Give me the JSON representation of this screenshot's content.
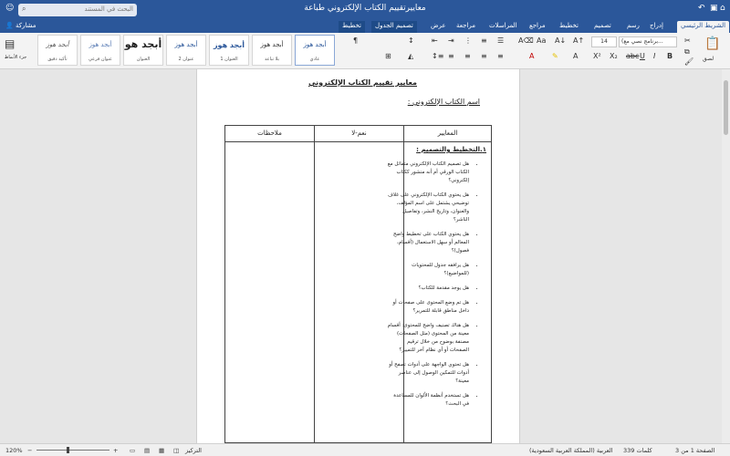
{
  "window": {
    "title": "معاييرتقييم الكتاب الإلكتروني طباعة",
    "search_placeholder": "البحث في المستند"
  },
  "share_label": "مشاركة",
  "tabs": [
    {
      "label": "الشريط الرئيسي"
    },
    {
      "label": "إدراج"
    },
    {
      "label": "رسم"
    },
    {
      "label": "تصميم"
    },
    {
      "label": "تخطيط"
    },
    {
      "label": "مراجع"
    },
    {
      "label": "المراسلات"
    },
    {
      "label": "مراجعة"
    },
    {
      "label": "عرض"
    },
    {
      "label": "تصميم الجدول"
    },
    {
      "label": "تخطيط"
    }
  ],
  "ribbon": {
    "paste_label": "لصق",
    "font_name": "(برنامج نصي مع...",
    "font_size": "14",
    "styles_pane_label": "جزء الأنماط",
    "styles": [
      {
        "preview": "أبجد هوز",
        "name": "عادي"
      },
      {
        "preview": "أبجد هوز",
        "name": "بلا تباعد"
      },
      {
        "preview": "أبجد هوز",
        "name": "العنوان 1"
      },
      {
        "preview": "أبجد هوز",
        "name": "عنوان 2"
      },
      {
        "preview": "أبجد هو",
        "name": "العنوان"
      },
      {
        "preview": "أبجد هوز",
        "name": "عنوان فرعي"
      },
      {
        "preview": "أبجد هوز",
        "name": "تأكيد دقيق"
      }
    ]
  },
  "document": {
    "title": "معايير تقييم الكتاب الإلكتروني",
    "book_name_label": "اسم الكتاب الإلكتروني :",
    "table": {
      "headers": [
        "المعايير",
        "نعم-لا",
        "ملاحظات"
      ],
      "section_heading": "١.التخطيط والتصميم :",
      "criteria": [
        "هل تصميم الكتاب الإلكتروني متماثل مع الكتاب الورقي أم أنه منشور ككتاب إلكتروني؟",
        "هل يحتوي الكتاب الإلكتروني على غلاف توضيحي يشتمل على اسم المؤلف، والعنوان، وتاريخ النشر، وتفاصيل الناشر؟",
        "هل يحتوي الكتاب على تخطيط واضح المعالم أو سهل الاستعمال (أقسام، فصول)؟",
        "هل يرافقه جدول للمحتويات (للمواضيع)؟",
        "هل يوجد مقدمة للكتاب؟",
        "هل تم وضع المحتوى على صفحات أو داخل مناطق قابلة للتمرير؟",
        "هل هناك تصنيف واضح للمحتوى: أقسام معينة من المحتوى (مثل الصفحات) مصنفة بوضوح من خلال ترقيم الصفحات أو أي نظام آخر للتمييز؟",
        "هل تحتوي الواجهة على أدوات تصفح أو أدوات للتمكين الوصول إلى عناصر معينة؟",
        "هل تستخدم أنظمة الألوان للمساعدة في البحث؟"
      ]
    }
  },
  "status": {
    "page_info": "الصفحة 1 من 3",
    "word_count": "339 كلمات",
    "language": "العربية (المملكة العربية السعودية)",
    "focus_label": "التركيز",
    "zoom": "120%"
  }
}
